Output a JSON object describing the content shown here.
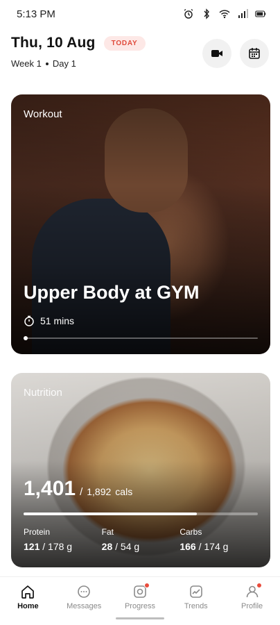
{
  "status_bar": {
    "time": "5:13 PM",
    "icons": [
      "alarm-icon",
      "bluetooth-icon",
      "wifi-icon",
      "signal-icon",
      "battery-icon"
    ]
  },
  "header": {
    "date": "Thu, 10 Aug",
    "today_badge": "TODAY",
    "week": "Week 1",
    "day": "Day 1",
    "actions": [
      "video-camera-icon",
      "calendar-icon"
    ]
  },
  "workout": {
    "label": "Workout",
    "title": "Upper Body at GYM",
    "duration": "51 mins",
    "pager_current": 1
  },
  "nutrition": {
    "label": "Nutrition",
    "calories": "1,401",
    "separator": "/",
    "calories_goal": "1,892",
    "calories_unit": "cals",
    "progress": 0.74,
    "macros": [
      {
        "label": "Protein",
        "value": "121",
        "goal": "/ 178 g"
      },
      {
        "label": "Fat",
        "value": "28",
        "goal": "/ 54 g"
      },
      {
        "label": "Carbs",
        "value": "166",
        "goal": "/ 174 g"
      }
    ]
  },
  "bottom_nav": {
    "items": [
      {
        "label": "Home",
        "icon": "home-icon",
        "active": true,
        "badge": false
      },
      {
        "label": "Messages",
        "icon": "chat-icon",
        "active": false,
        "badge": false
      },
      {
        "label": "Progress",
        "icon": "progress-icon",
        "active": false,
        "badge": true
      },
      {
        "label": "Trends",
        "icon": "trends-icon",
        "active": false,
        "badge": false
      },
      {
        "label": "Profile",
        "icon": "profile-icon",
        "active": false,
        "badge": true
      }
    ]
  },
  "colors": {
    "accent": "#e94c3c",
    "badge_bg": "#fde8e6",
    "text": "#111111",
    "muted": "#8a8a8a"
  }
}
